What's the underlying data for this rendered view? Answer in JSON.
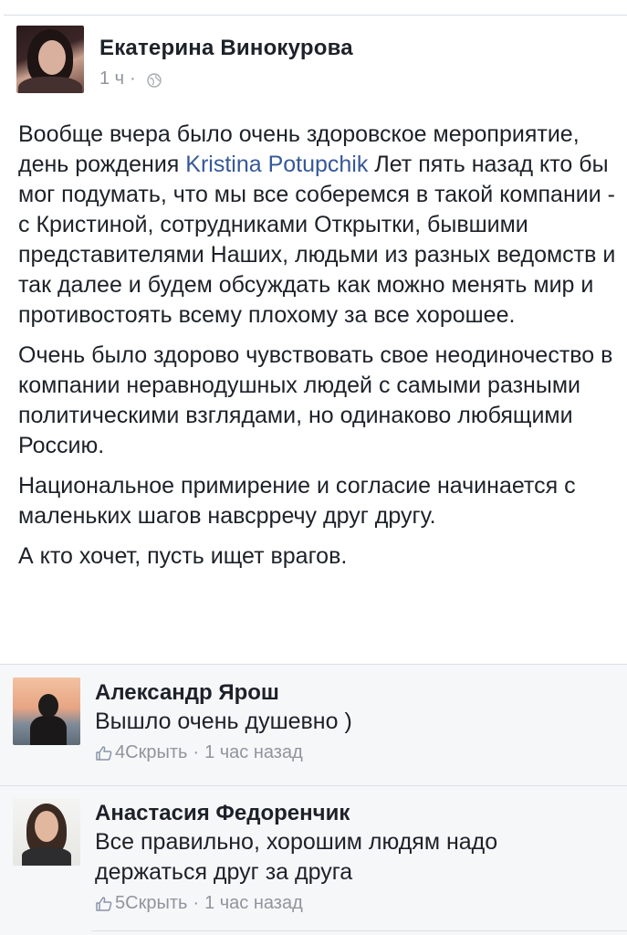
{
  "post": {
    "author": "Екатерина Винокурова",
    "time": "1 ч",
    "separator": "·",
    "paragraphs": {
      "p1_before": "Вообще вчера было очень здоровское мероприятие, день рождения ",
      "p1_mention": "Kristina Potupchik",
      "p1_after": " Лет пять назад кто бы мог подумать, что мы все соберемся в такой компании - с Кристиной, сотрудниками Открытки, бывшими представителями Наших, людьми из разных ведомств и так далее и будем обсуждать как можно менять мир и противостоять всему плохому за все хорошее.",
      "p2": "Очень было здорово чувствовать свое неодиночество в компании неравнодушных людей с самыми разными политическими взглядами, но одинаково любящими Россию.",
      "p3": "Национальное примирение и согласие начинается с маленьких шагов навсрречу друг другу.",
      "p4": "А кто хочет, пусть ищет врагов."
    },
    "colors": {
      "text": "#1d2129",
      "mention": "#365899",
      "meta": "#90949c"
    },
    "icons": {
      "audience": "globe-icon"
    }
  },
  "comments": [
    {
      "author": "Александр Ярош",
      "text": "Вышло очень душевно )",
      "likes": "4",
      "hide_label": "Скрыть",
      "separator": "·",
      "time": "1 час назад"
    },
    {
      "author": "Анастасия Федоренчик",
      "text": "Все правильно, хорошим людям надо держаться друг за друга",
      "likes": "5",
      "hide_label": "Скрыть",
      "separator": "·",
      "time": "1 час назад"
    }
  ]
}
